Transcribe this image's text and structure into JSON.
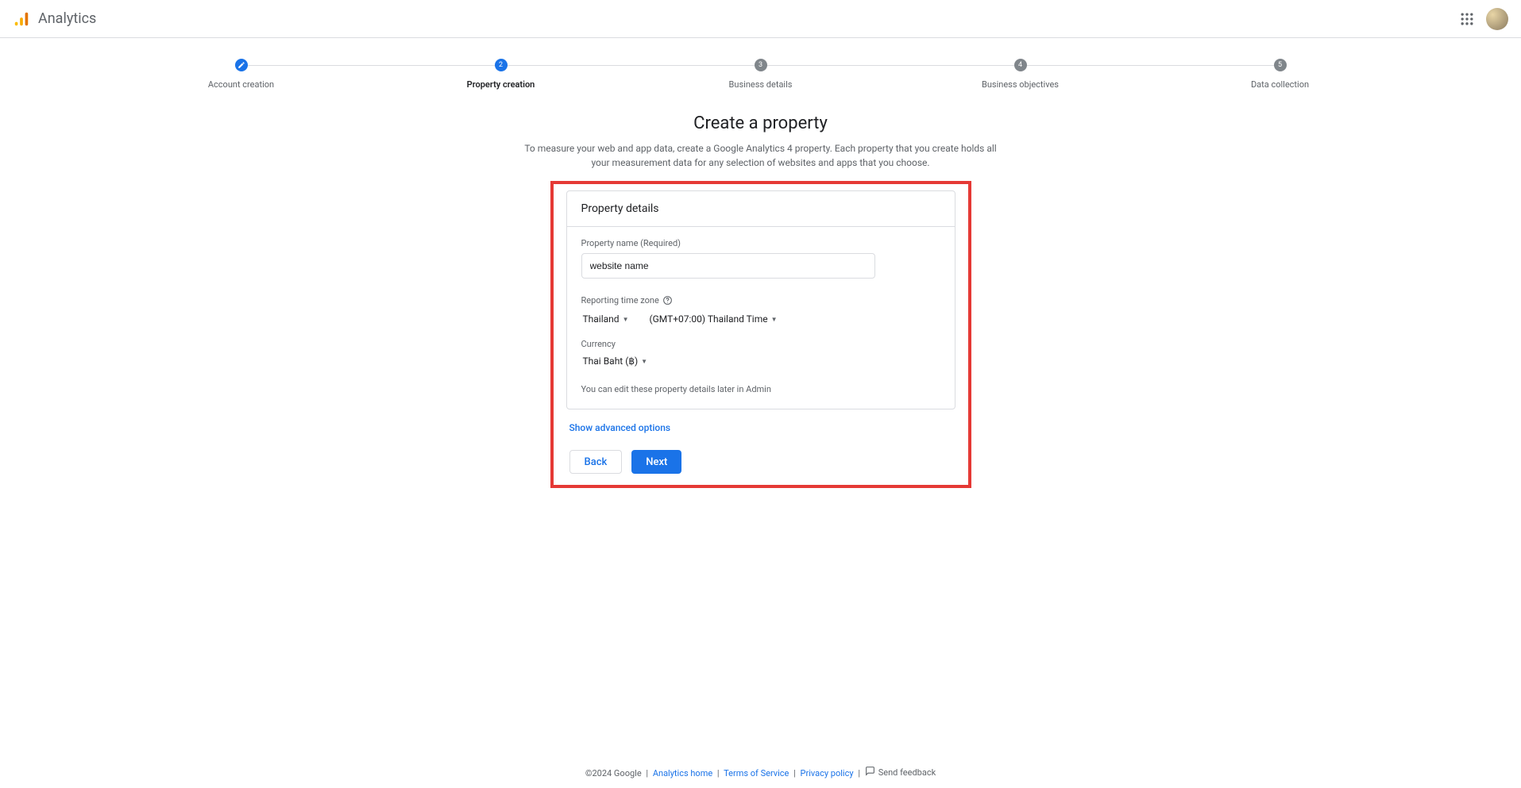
{
  "header": {
    "app_title": "Analytics"
  },
  "stepper": {
    "steps": [
      {
        "label": "Account creation",
        "state": "done",
        "marker": "✎"
      },
      {
        "label": "Property creation",
        "state": "active",
        "marker": "2"
      },
      {
        "label": "Business details",
        "state": "pending",
        "marker": "3"
      },
      {
        "label": "Business objectives",
        "state": "pending",
        "marker": "4"
      },
      {
        "label": "Data collection",
        "state": "pending",
        "marker": "5"
      }
    ]
  },
  "page": {
    "title": "Create a property",
    "subtitle": "To measure your web and app data, create a Google Analytics 4 property. Each property that you create holds all your measurement data for any selection of websites and apps that you choose."
  },
  "card": {
    "header": "Property details",
    "property_name_label": "Property name (Required)",
    "property_name_value": "website name",
    "timezone_label": "Reporting time zone",
    "timezone_country": "Thailand",
    "timezone_value": "(GMT+07:00) Thailand Time",
    "currency_label": "Currency",
    "currency_value": "Thai Baht (฿)",
    "note": "You can edit these property details later in Admin"
  },
  "advanced_link": "Show advanced options",
  "buttons": {
    "back": "Back",
    "next": "Next"
  },
  "footer": {
    "copyright": "©2024 Google",
    "links": {
      "analytics_home": "Analytics home",
      "terms": "Terms of Service",
      "privacy": "Privacy policy"
    },
    "feedback": "Send feedback"
  }
}
